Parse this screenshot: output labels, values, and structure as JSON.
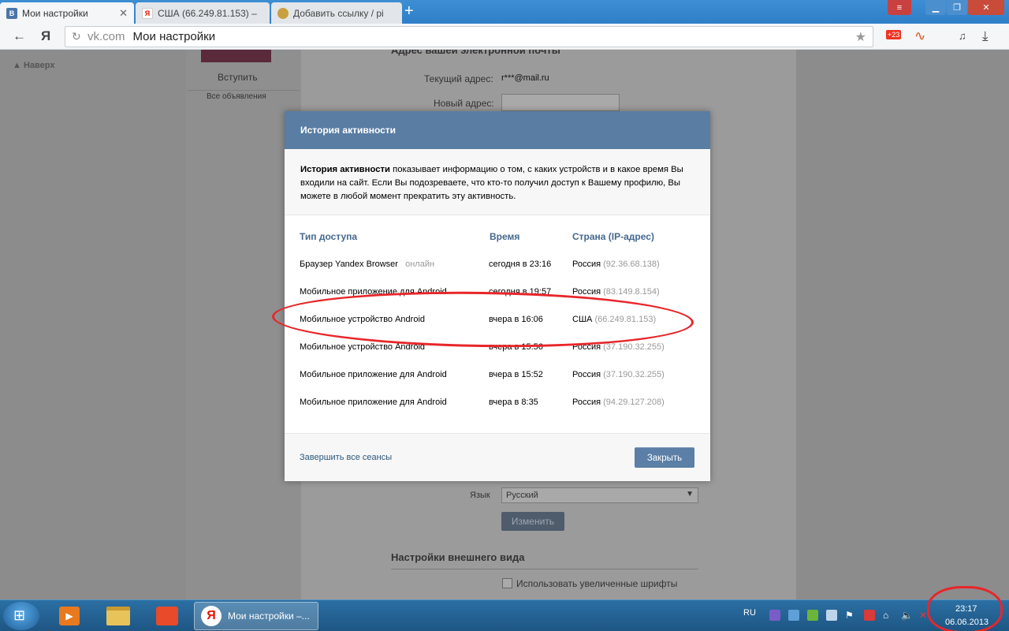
{
  "browser": {
    "tabs": [
      {
        "label": "Мои настройки",
        "favicon": "В",
        "active": true
      },
      {
        "label": "США (66.249.81.153) –",
        "favicon": "Я",
        "active": false
      },
      {
        "label": "Добавить ссылку / pi",
        "favicon": "",
        "active": false
      }
    ],
    "url_domain": "vk.com",
    "url_title": "Мои настройки",
    "nav_logo": "Я",
    "badge_count": "+23"
  },
  "page": {
    "back_link": "Наверх",
    "join": "Вступить",
    "all_ads": "Все объявления",
    "email_section_title": "Адрес вашей электронной почты",
    "current_address_label": "Текущий адрес:",
    "current_address_value": "r***@mail.ru",
    "new_address_label": "Новый адрес:",
    "language_label": "Язык",
    "language_value": "Русский",
    "change_button": "Изменить",
    "appearance_title": "Настройки внешнего вида",
    "large_fonts_label": "Использовать увеличенные шрифты"
  },
  "modal": {
    "title": "История активности",
    "desc_bold": "История активности",
    "desc_rest": " показывает информацию о том, с каких устройств и в какое время Вы входили на сайт. Если Вы подозреваете, что кто-то получил доступ к Вашему профилю, Вы можете в любой момент прекратить эту активность.",
    "columns": [
      "Тип доступа",
      "Время",
      "Страна (IP-адрес)"
    ],
    "rows": [
      {
        "type": "Браузер Yandex Browser",
        "status": "онлайн",
        "time": "сегодня в 23:16",
        "country": "Россия",
        "ip": "(92.36.68.138)"
      },
      {
        "type": "Мобильное приложение для Android",
        "status": "",
        "time": "сегодня в 19:57",
        "country": "Россия",
        "ip": "(83.149.8.154)"
      },
      {
        "type": "Мобильное устройство Android",
        "status": "",
        "time": "вчера в 16:06",
        "country": "США",
        "ip": "(66.249.81.153)"
      },
      {
        "type": "Мобильное устройство Android",
        "status": "",
        "time": "вчера в 15:56",
        "country": "Россия",
        "ip": "(37.190.32.255)"
      },
      {
        "type": "Мобильное приложение для Android",
        "status": "",
        "time": "вчера в 15:52",
        "country": "Россия",
        "ip": "(37.190.32.255)"
      },
      {
        "type": "Мобильное приложение для Android",
        "status": "",
        "time": "вчера в 8:35",
        "country": "Россия",
        "ip": "(94.29.127.208)"
      }
    ],
    "end_sessions": "Завершить все сеансы",
    "close": "Закрыть"
  },
  "taskbar": {
    "active_window": "Мои настройки –...",
    "lang": "RU",
    "time": "23:17",
    "date": "06.06.2013"
  },
  "colors": {
    "vk_blue": "#597da3",
    "link": "#2b587a",
    "highlight": "#e8262a"
  }
}
